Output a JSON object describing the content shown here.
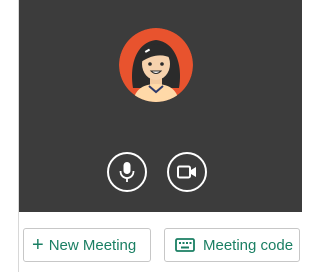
{
  "preview": {
    "avatar_name": "user-avatar",
    "mic_icon": "microphone-icon",
    "camera_icon": "video-camera-icon"
  },
  "actions": {
    "new_meeting_icon": "+",
    "new_meeting_label": "New Meeting",
    "meeting_code_icon": "keyboard-icon",
    "meeting_code_label": "Meeting code"
  },
  "colors": {
    "preview_bg": "#3c3c3c",
    "accent": "#1a7f63",
    "avatar_bg": "#e8532e"
  }
}
